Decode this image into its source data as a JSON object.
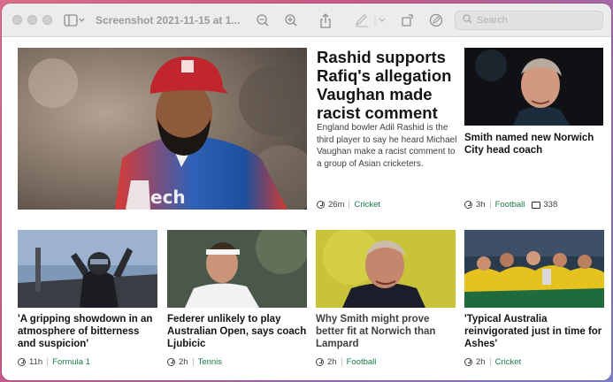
{
  "toolbar": {
    "title": "Screenshot 2021-11-15 at 1...",
    "search_placeholder": "Search"
  },
  "lead": {
    "title": "Rashid supports Rafiq's allegation Vaughan made racist comment",
    "summary": "England bowler Adil Rashid is the third player to say he heard Michael Vaughan make a racist comment to a group of Asian cricketers.",
    "time": "26m",
    "topic": "Cricket"
  },
  "side": {
    "title": "Smith named new Norwich City head coach",
    "time": "3h",
    "topic": "Football",
    "comments": "338"
  },
  "bottom": [
    {
      "title": "'A gripping showdown in an atmosphere of bitterness and suspicion'",
      "time": "11h",
      "topic": "Formula 1"
    },
    {
      "title": "Federer unlikely to play Australian Open, says coach Ljubicic",
      "time": "2h",
      "topic": "Tennis"
    },
    {
      "title": "Why Smith might prove better fit at Norwich than Lampard",
      "time": "2h",
      "topic": "Football"
    },
    {
      "title": "'Typical Australia reinvigorated just in time for Ashes'",
      "time": "2h",
      "topic": "Cricket"
    }
  ],
  "colors": {
    "topic": "#1a7a48",
    "lead_bg": "#2b6fc0",
    "accent_red": "#c0262b"
  },
  "icons": [
    "sidebar-icon",
    "zoom-out-icon",
    "zoom-in-icon",
    "share-icon",
    "markup-pen-icon",
    "rotate-icon",
    "annotate-icon",
    "search-icon",
    "clock-icon",
    "comment-icon"
  ]
}
